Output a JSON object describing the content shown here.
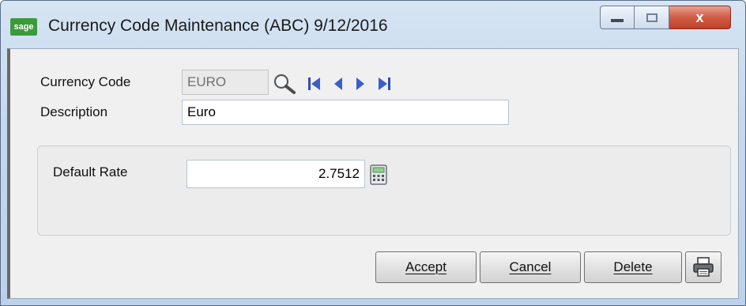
{
  "window": {
    "title": "Currency Code Maintenance (ABC) 9/12/2016",
    "app_icon_text": "sage",
    "close_glyph": "x"
  },
  "form": {
    "currency_code_label": "Currency Code",
    "currency_code_value": "EURO",
    "description_label": "Description",
    "description_value": "Euro",
    "default_rate_label": "Default Rate",
    "default_rate_value": "2.7512"
  },
  "buttons": {
    "accept": "Accept",
    "cancel": "Cancel",
    "delete": "Delete"
  },
  "icons": {
    "lookup": "magnifier-icon",
    "first": "first-record-icon",
    "prev": "previous-record-icon",
    "next": "next-record-icon",
    "last": "last-record-icon",
    "calculator": "calculator-icon",
    "print": "printer-icon"
  }
}
